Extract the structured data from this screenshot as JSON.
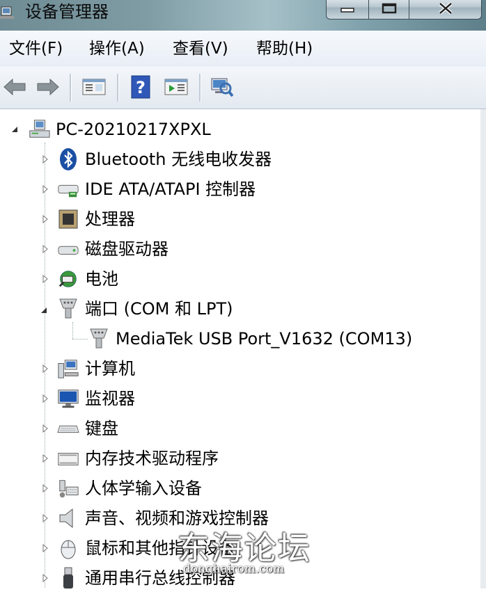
{
  "window": {
    "title": "设备管理器"
  },
  "menu": [
    "文件(F)",
    "操作(A)",
    "查看(V)",
    "帮助(H)"
  ],
  "toolbar": [
    "back-icon",
    "forward-icon",
    "properties-panel-icon",
    "help-icon",
    "update-driver-icon",
    "scan-hardware-icon"
  ],
  "tree": {
    "root": "PC-20210217XPXL",
    "items": [
      {
        "label": "Bluetooth 无线电收发器",
        "icon": "bluetooth-icon"
      },
      {
        "label": "IDE ATA/ATAPI 控制器",
        "icon": "ide-controller-icon"
      },
      {
        "label": "处理器",
        "icon": "processor-icon"
      },
      {
        "label": "磁盘驱动器",
        "icon": "disk-drive-icon"
      },
      {
        "label": "电池",
        "icon": "battery-icon"
      },
      {
        "label": "端口 (COM 和 LPT)",
        "icon": "port-icon",
        "expanded": true,
        "children": [
          {
            "label": "MediaTek USB Port_V1632 (COM13)",
            "icon": "port-icon"
          }
        ]
      },
      {
        "label": "计算机",
        "icon": "computer-icon"
      },
      {
        "label": "监视器",
        "icon": "monitor-icon"
      },
      {
        "label": "键盘",
        "icon": "keyboard-icon"
      },
      {
        "label": "内存技术驱动程序",
        "icon": "memory-tech-icon"
      },
      {
        "label": "人体学输入设备",
        "icon": "hid-icon"
      },
      {
        "label": "声音、视频和游戏控制器",
        "icon": "sound-icon"
      },
      {
        "label": "鼠标和其他指针设备",
        "icon": "mouse-icon"
      },
      {
        "label": "通用串行总线控制器",
        "icon": "usb-icon"
      }
    ]
  },
  "watermark": {
    "title": "东海论坛",
    "url": "donghairom.com"
  }
}
